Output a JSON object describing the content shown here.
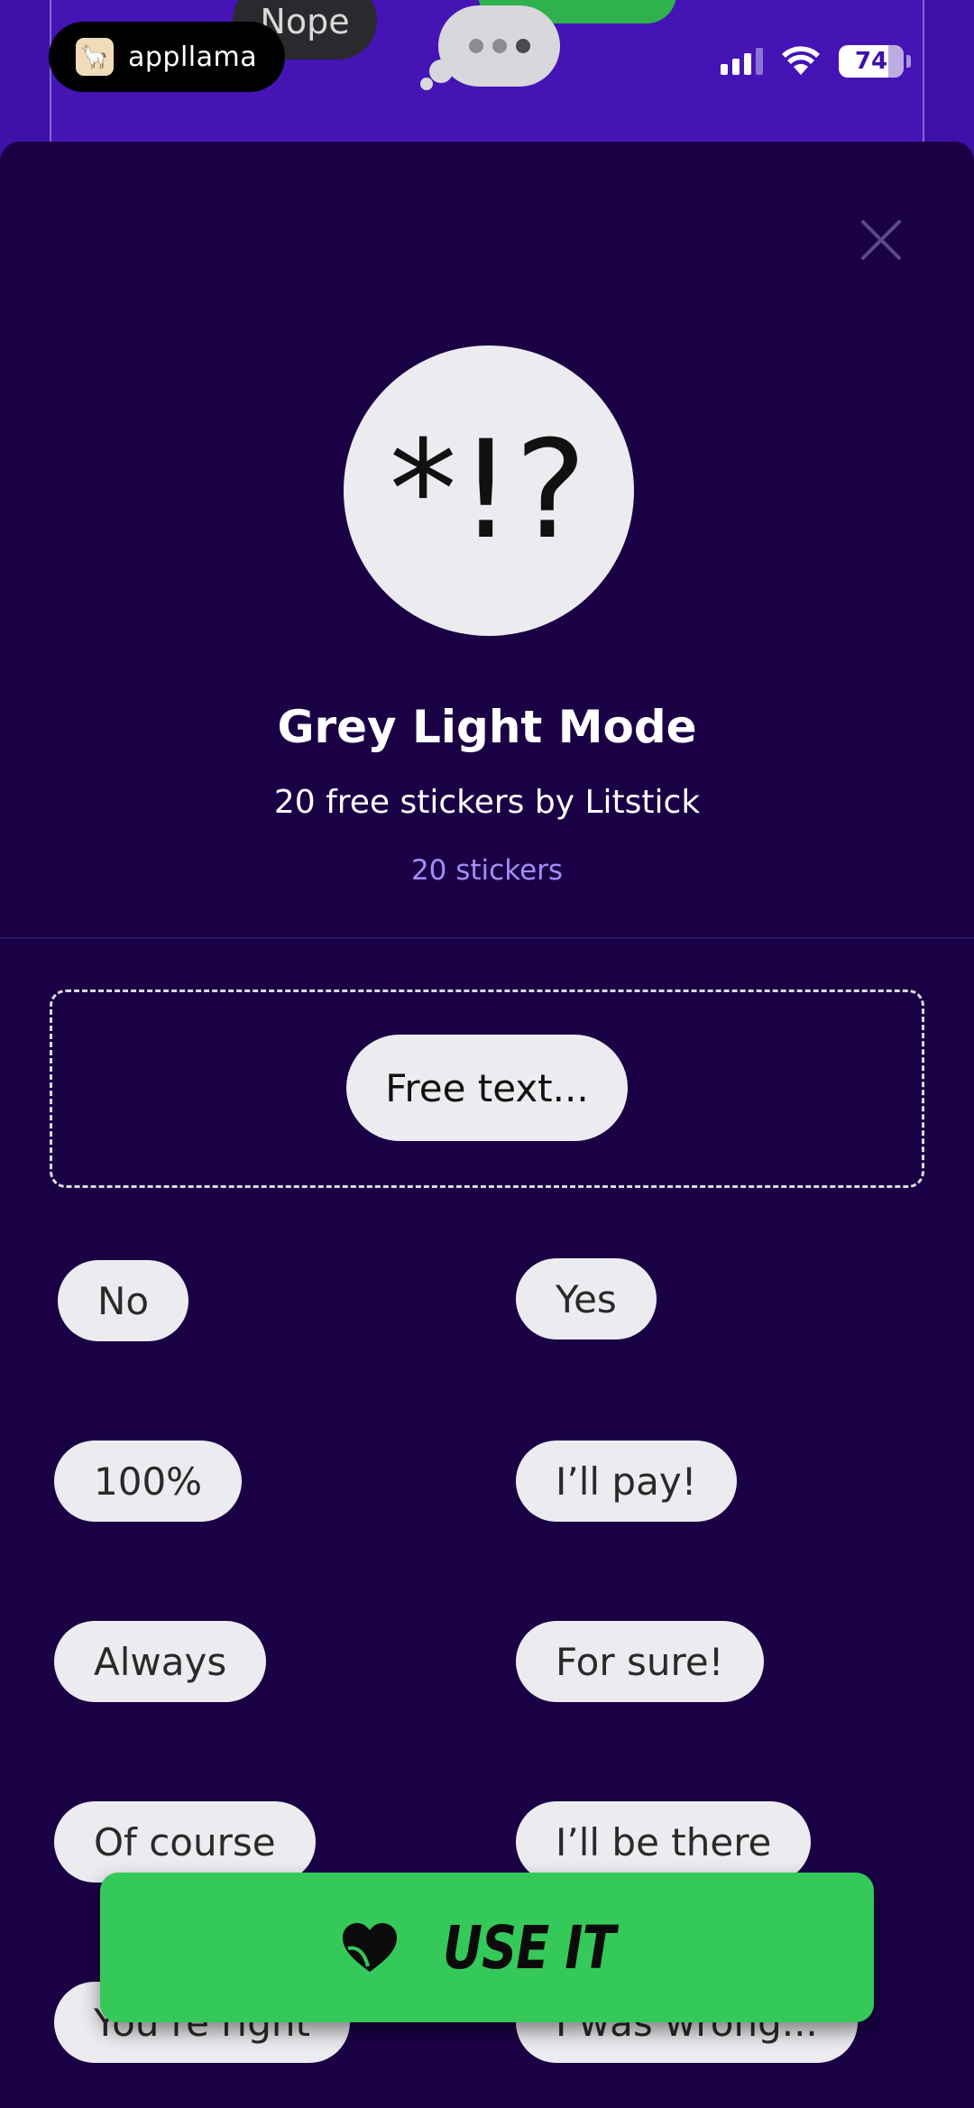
{
  "background": {
    "bubble_nope": "Nope"
  },
  "status_bar": {
    "brand": "appllama",
    "battery": "74"
  },
  "sheet": {
    "sticker_preview": "*!?",
    "title": "Grey Light Mode",
    "subtitle": "20 free stickers by Litstick",
    "count": "20 stickers",
    "free_text": "Free text..."
  },
  "stickers": [
    "No",
    "Yes",
    "100%",
    "I’ll pay!",
    "Always",
    "For sure!",
    "Of course",
    "I’ll be there",
    "You’re right",
    "I was wrong..."
  ],
  "cta": {
    "label": "USE IT",
    "color": "#35c95a"
  },
  "colors": {
    "sheet_bg": "#1a0045",
    "header_bg": "#3e11a8",
    "count_text": "#a78bfa"
  }
}
